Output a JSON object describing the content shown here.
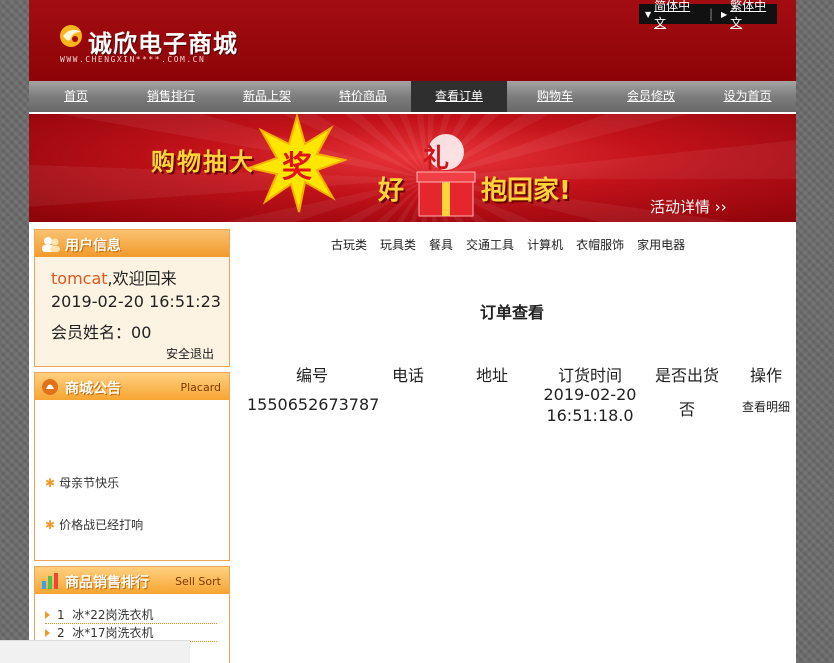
{
  "header": {
    "logo_title": "诚欣电子商城",
    "logo_url": "WWW.CHENGXIN****.COM.CN",
    "lang_simplified": "简体中文",
    "lang_traditional": "繁体中文"
  },
  "nav": {
    "items": [
      {
        "label": "首页"
      },
      {
        "label": "销售排行"
      },
      {
        "label": "新品上架"
      },
      {
        "label": "特价商品"
      },
      {
        "label": "查看订单"
      },
      {
        "label": "购物车"
      },
      {
        "label": "会员修改"
      },
      {
        "label": "设为首页"
      }
    ],
    "active": "查看订单"
  },
  "banner": {
    "text1": "购物抽大",
    "burst_word": "奖",
    "text2a": "好",
    "gift_word": "礼",
    "text2b": "抱回家!",
    "more": "活动详情 ››"
  },
  "user_box": {
    "title": "用户信息",
    "username": "tomcat",
    "welcome": ",欢迎回来",
    "time": "2019-02-20 16:51:23",
    "member_label": "会员姓名：",
    "member_name": "00",
    "logout": "安全退出"
  },
  "notice_box": {
    "title": "商城公告",
    "title_en": "Placard",
    "items": [
      "母亲节快乐",
      "价格战已经打响"
    ]
  },
  "rank_box": {
    "title": "商品销售排行",
    "title_en": "Sell Sort",
    "items": [
      {
        "rank": "1",
        "name": "冰*22岗洗衣机"
      },
      {
        "rank": "2",
        "name": "冰*17岗洗衣机"
      }
    ]
  },
  "categories": [
    "古玩类",
    "玩具类",
    "餐具",
    "交通工具",
    "计算机",
    "衣帽服饰",
    "家用电器"
  ],
  "orders": {
    "heading": "订单查看",
    "columns": [
      "编号",
      "电话",
      "地址",
      "订货时间",
      "是否出货",
      "操作"
    ],
    "rows": [
      {
        "id": "1550652673787",
        "phone": "",
        "address": "",
        "time_date": "2019-02-20",
        "time_clock": "16:51:18.0",
        "shipped": "否",
        "action": "查看明细"
      }
    ]
  }
}
